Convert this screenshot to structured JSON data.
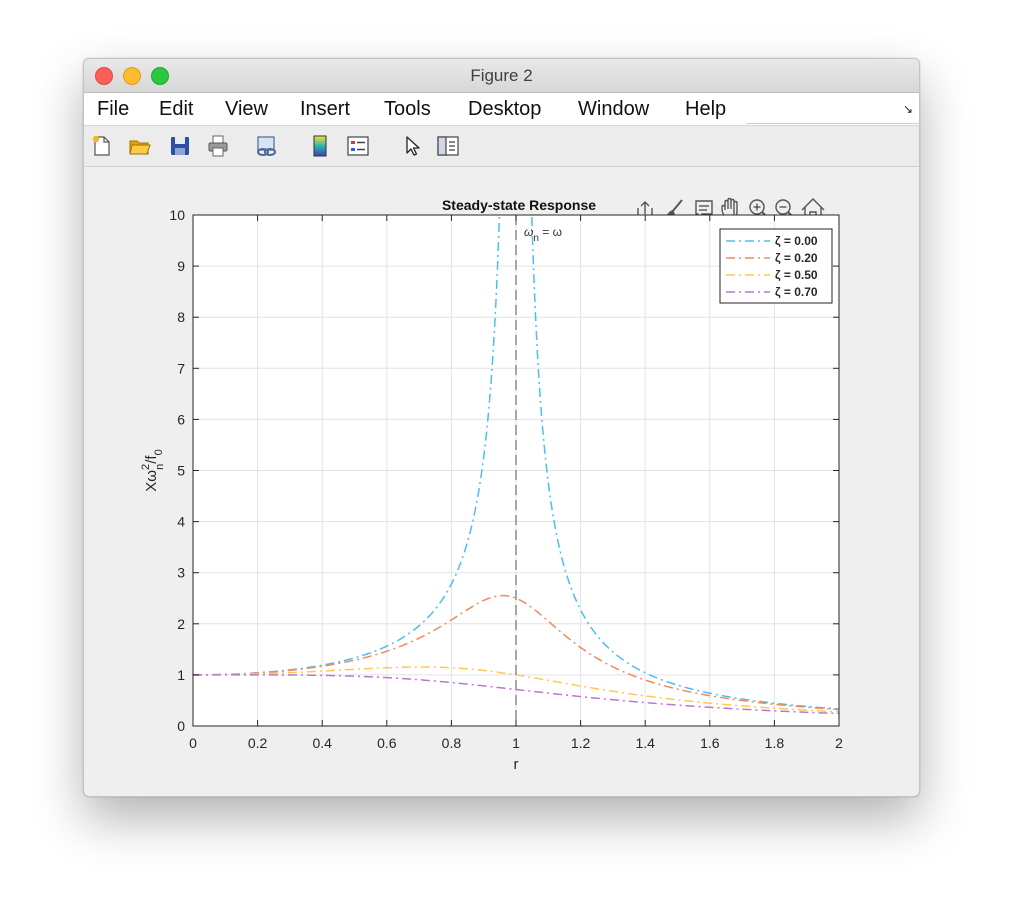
{
  "window": {
    "title": "Figure 2"
  },
  "menu": [
    "File",
    "Edit",
    "View",
    "Insert",
    "Tools",
    "Desktop",
    "Window",
    "Help"
  ],
  "toolbar": [
    "new-figure-icon",
    "open-folder-icon",
    "save-icon",
    "print-icon",
    "link-plot-icon",
    "colorbar-icon",
    "legend-icon",
    "pointer-icon",
    "property-inspector-icon"
  ],
  "axes_toolbar": [
    "export-icon",
    "brush-icon",
    "datatip-icon",
    "pan-hand-icon",
    "zoom-in-icon",
    "zoom-out-icon",
    "home-icon"
  ],
  "colors": {
    "zeta0": "#4dbeee",
    "zeta02": "#f28a5b",
    "zeta05": "#ffc94d",
    "zeta07": "#b878d0"
  },
  "chart_data": {
    "type": "line",
    "title": "Steady-state Response",
    "xlabel": "r",
    "ylabel": {
      "base": "Xω",
      "sup": "2",
      "sub_n": "n",
      "mid": "/f",
      "sub0": "0"
    },
    "xlim": [
      0,
      2
    ],
    "ylim": [
      0,
      10
    ],
    "xticks": [
      0,
      0.2,
      0.4,
      0.6,
      0.8,
      1,
      1.2,
      1.4,
      1.6,
      1.8,
      2
    ],
    "xticklabels": [
      "0",
      "0.2",
      "0.4",
      "0.6",
      "0.8",
      "1",
      "1.2",
      "1.4",
      "1.6",
      "1.8",
      "2"
    ],
    "yticks": [
      0,
      1,
      2,
      3,
      4,
      5,
      6,
      7,
      8,
      9,
      10
    ],
    "yticklabels": [
      "0",
      "1",
      "2",
      "3",
      "4",
      "5",
      "6",
      "7",
      "8",
      "9",
      "10"
    ],
    "grid": true,
    "legend_location": "top-right",
    "vline": {
      "x": 1,
      "label": {
        "base": "ω",
        "sub": "n",
        "rest": " = ω"
      }
    },
    "series": [
      {
        "name": "ζ = 0.00",
        "zeta": 0.0,
        "color": "#4dbeee",
        "style": "dash-dot"
      },
      {
        "name": "ζ = 0.20",
        "zeta": 0.2,
        "color": "#f28a5b",
        "style": "dash-dot"
      },
      {
        "name": "ζ = 0.50",
        "zeta": 0.5,
        "color": "#ffc94d",
        "style": "dash-dot"
      },
      {
        "name": "ζ = 0.70",
        "zeta": 0.7,
        "color": "#b878d0",
        "style": "dash-dot"
      }
    ]
  }
}
